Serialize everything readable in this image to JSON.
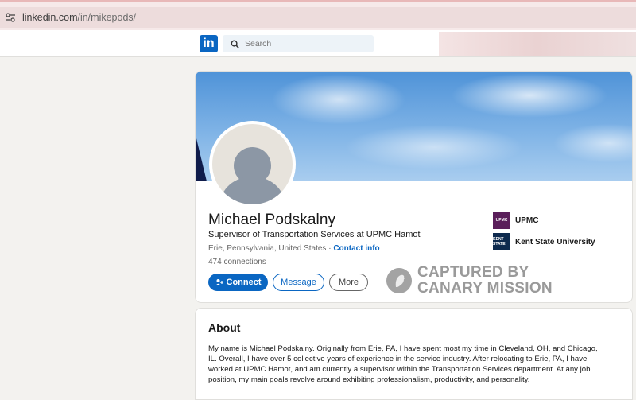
{
  "browser": {
    "url_host": "linkedin.com",
    "url_path": "/in/mikepods/"
  },
  "nav": {
    "logo_text": "in",
    "search_placeholder": "Search"
  },
  "profile": {
    "name": "Michael Podskalny",
    "headline": "Supervisor of Transportation Services at UPMC Hamot",
    "location": "Erie, Pennsylvania, United States",
    "separator": " · ",
    "contact_info": "Contact info",
    "connections": "474 connections",
    "actions": {
      "connect": "Connect",
      "message": "Message",
      "more": "More"
    },
    "organizations": [
      {
        "name": "UPMC",
        "logo_text": "UPMC"
      },
      {
        "name": "Kent State University",
        "logo_text": "KENT STATE"
      }
    ]
  },
  "watermark": {
    "line1": "CAPTURED BY",
    "line2": "CANARY MISSION"
  },
  "about": {
    "title": "About",
    "text": "My name is Michael Podskalny. Originally from Erie, PA, I have spent most my time in Cleveland, OH, and Chicago, IL. Overall, I have over 5 collective years of experience in the service industry. After relocating to Erie, PA, I have worked at UPMC Hamot, and am currently a supervisor within the Transportation Services department. At any job position, my main goals revolve around exhibiting professionalism, productivity, and personality."
  },
  "colors": {
    "brand": "#0a66c2",
    "page_bg": "#f3f2ef"
  }
}
